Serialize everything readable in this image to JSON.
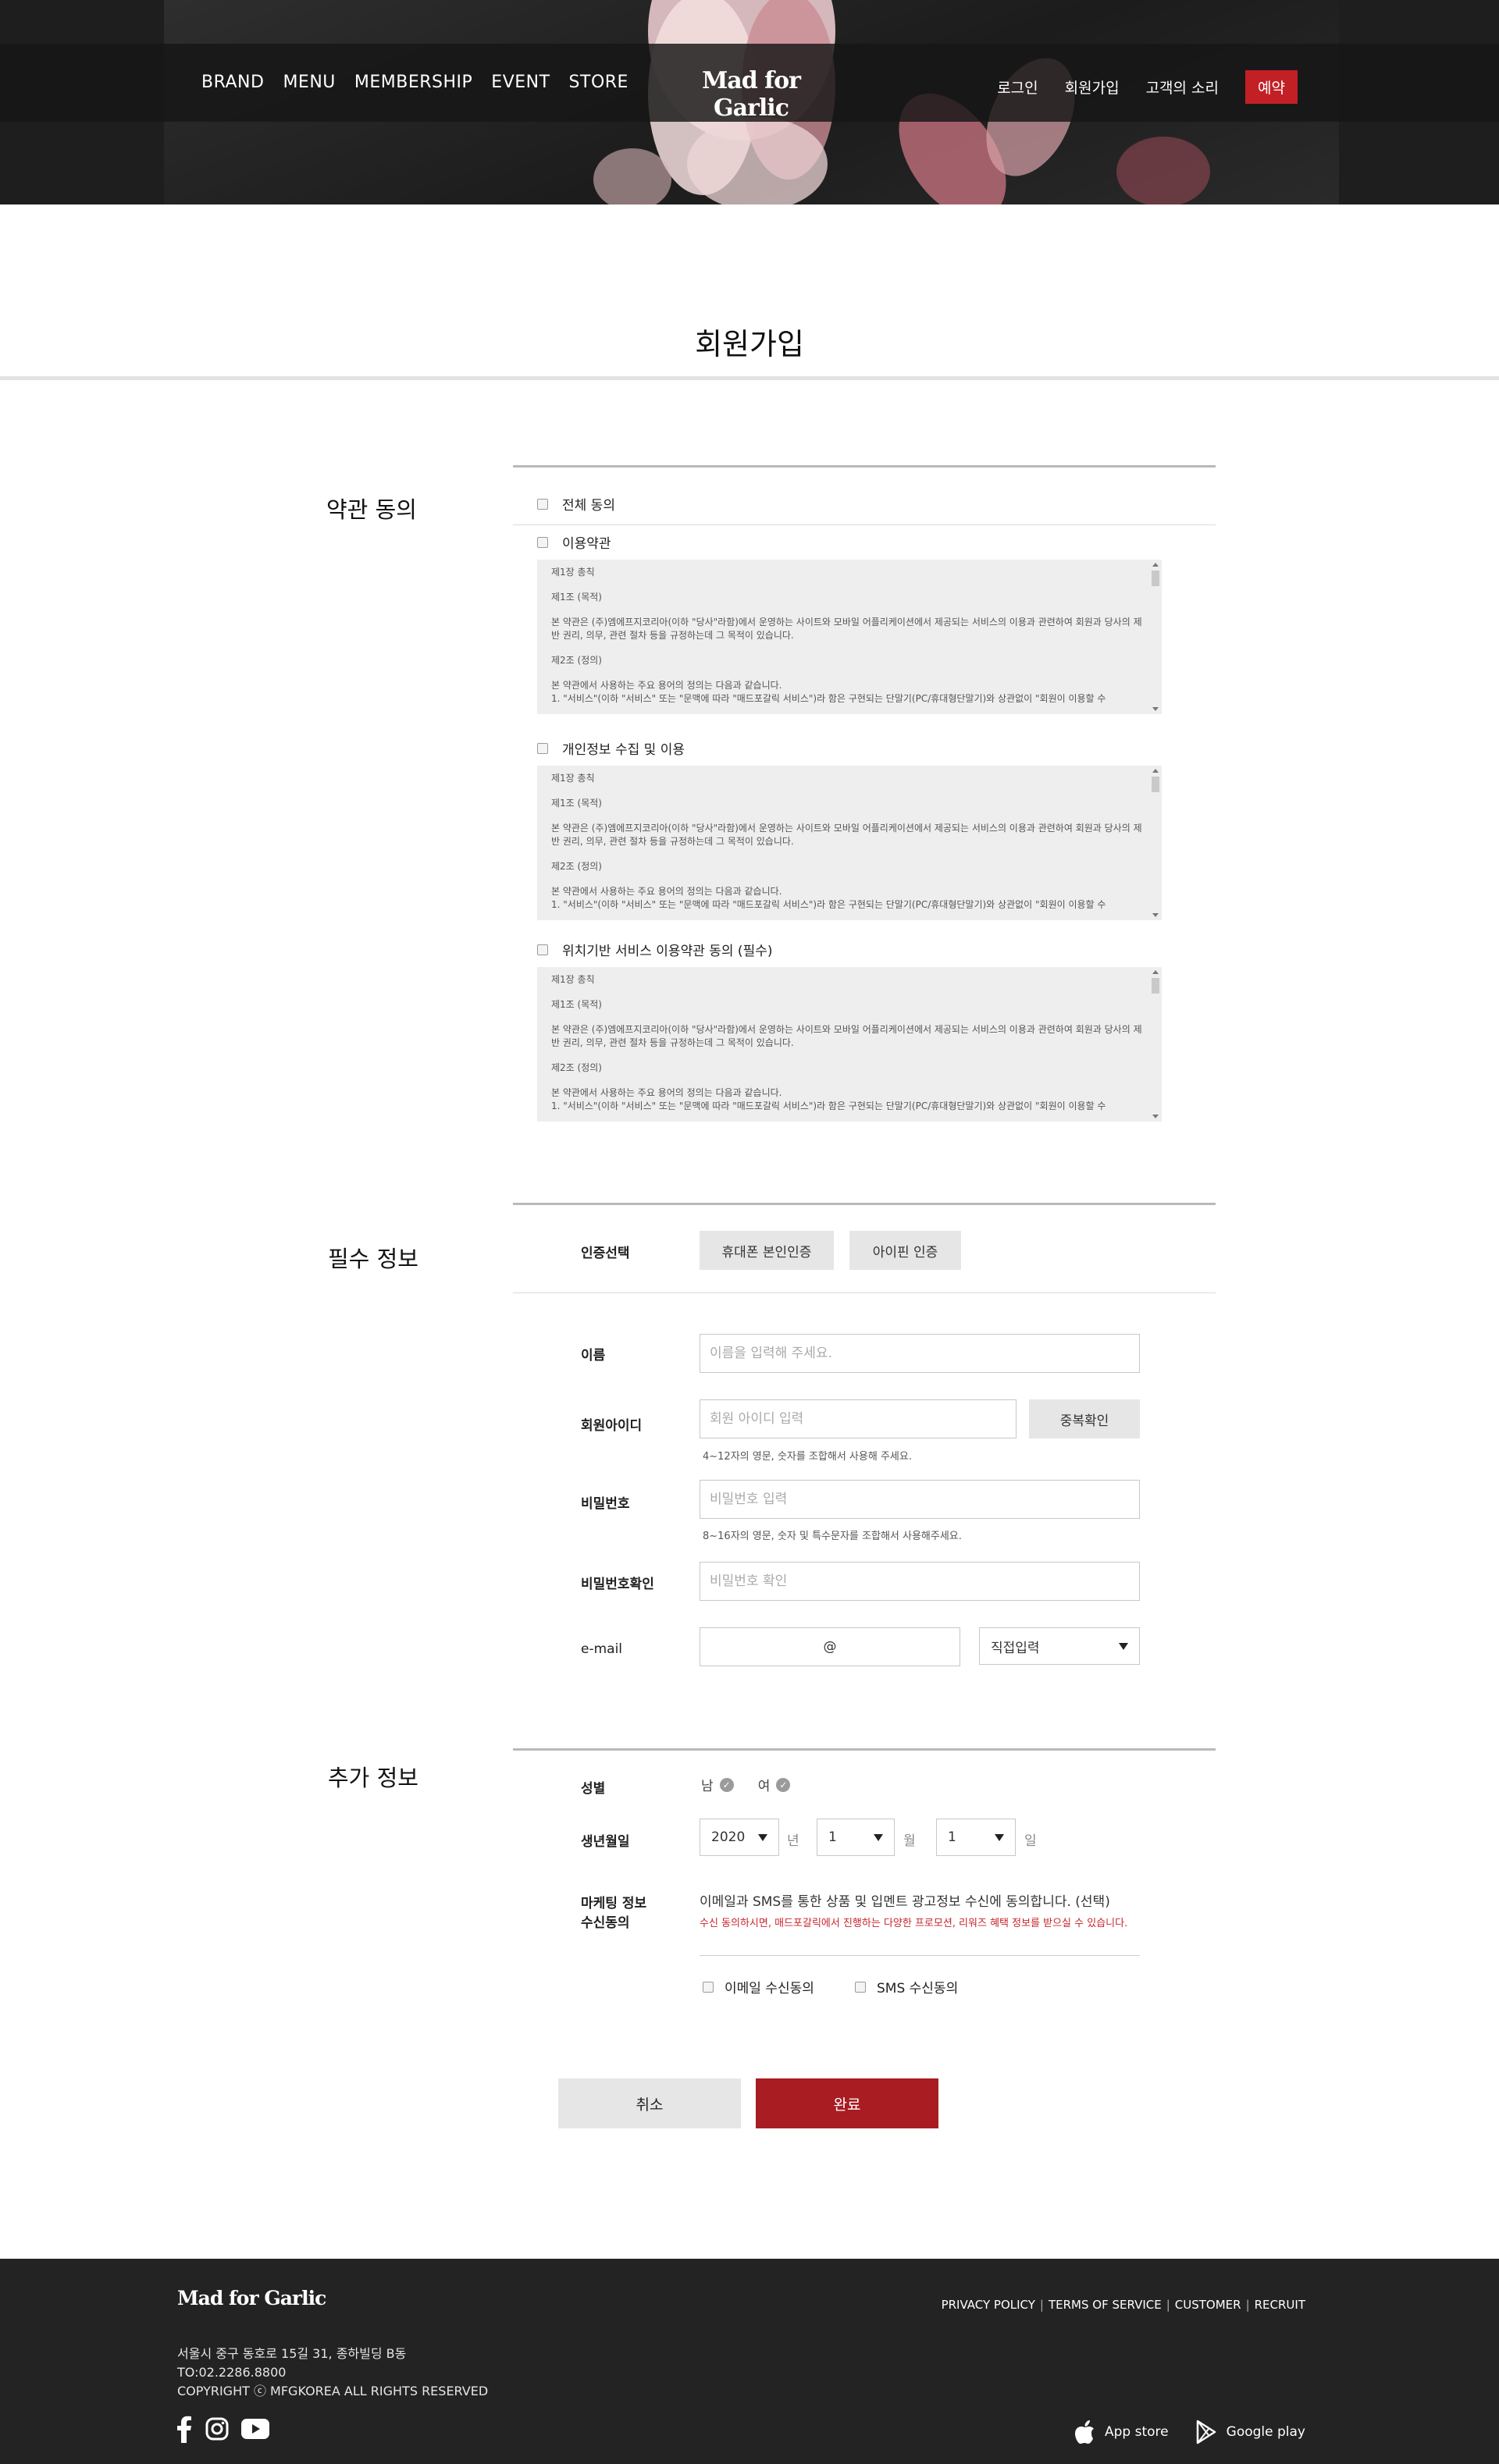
{
  "nav": {
    "left": [
      "BRAND",
      "MENU",
      "MEMBERSHIP",
      "EVENT",
      "STORE"
    ],
    "logo": "Mad for Garlic",
    "right": [
      "로그인",
      "회원가입",
      "고객의 소리"
    ],
    "reserve": "예약",
    "accent_color": "#c32026"
  },
  "page_title": "회원가입",
  "terms": {
    "section_title": "약관 동의",
    "agree_all": "전체 동의",
    "items": [
      {
        "label": "이용약관",
        "lines": [
          "제1장 총칙",
          "제1조 (목적)",
          "본 약관은 (주)엠에프지코리아(이하 \"당사\"라함)에서 운영하는 사이트와 모바일 어플리케이션에서 제공되는 서비스의 이용과 관련하여 회원과 당사의 제반 권리, 의무, 관련 절차 등을 규정하는데 그 목적이 있습니다.",
          "제2조 (정의)",
          "본 약관에서 사용하는 주요 용어의 정의는 다음과 같습니다.",
          "1. \"서비스\"(이하 \"서비스\" 또는 \"문맥에 따라 \"매드포갈릭 서비스\")라 함은 구현되는 단말기(PC/휴대형단말기)와 상관없이 \"회원이 이용할 수"
        ]
      },
      {
        "label": "개인정보 수집 및 이용",
        "lines": [
          "제1장 총칙",
          "제1조 (목적)",
          "본 약관은 (주)엠에프지코리아(이하 \"당사\"라함)에서 운영하는 사이트와 모바일 어플리케이션에서 제공되는 서비스의 이용과 관련하여 회원과 당사의 제반 권리, 의무, 관련 절차 등을 규정하는데 그 목적이 있습니다.",
          "제2조 (정의)",
          "본 약관에서 사용하는 주요 용어의 정의는 다음과 같습니다.",
          "1. \"서비스\"(이하 \"서비스\" 또는 \"문맥에 따라 \"매드포갈릭 서비스\")라 함은 구현되는 단말기(PC/휴대형단말기)와 상관없이 \"회원이 이용할 수"
        ]
      },
      {
        "label": "위치기반 서비스 이용약관 동의 (필수)",
        "lines": [
          "제1장 총칙",
          "제1조 (목적)",
          "본 약관은 (주)엠에프지코리아(이하 \"당사\"라함)에서 운영하는 사이트와 모바일 어플리케이션에서 제공되는 서비스의 이용과 관련하여 회원과 당사의 제반 권리, 의무, 관련 절차 등을 규정하는데 그 목적이 있습니다.",
          "제2조 (정의)",
          "본 약관에서 사용하는 주요 용어의 정의는 다음과 같습니다.",
          "1. \"서비스\"(이하 \"서비스\" 또는 \"문맥에 따라 \"매드포갈릭 서비스\")라 함은 구현되는 단말기(PC/휴대형단말기)와 상관없이 \"회원이 이용할 수"
        ]
      }
    ]
  },
  "required": {
    "section_title": "필수 정보",
    "auth_label": "인증선택",
    "auth_phone": "휴대폰 본인인증",
    "auth_ipin": "아이핀 인증",
    "name_label": "이름",
    "name_placeholder": "이름을 입력해 주세요.",
    "id_label": "회원아이디",
    "id_placeholder": "회원 아이디 입력",
    "id_check": "중복확인",
    "id_help": "4~12자의 영문, 숫자를 조합해서 사용해 주세요.",
    "pw_label": "비밀번호",
    "pw_placeholder": "비밀번호 입력",
    "pw_help": "8~16자의 영문, 숫자 및 특수문자를 조합해서 사용해주세요.",
    "pw2_label": "비밀번호확인",
    "pw2_placeholder": "비밀번호 확인",
    "email_label": "e-mail",
    "email_at": "@",
    "email_select": "직접입력"
  },
  "extra": {
    "section_title": "추가 정보",
    "gender_label": "성별",
    "gender_male": "남",
    "gender_female": "여",
    "birth_label": "생년월일",
    "birth_year": "2020",
    "birth_year_suffix": "년",
    "birth_month": "1",
    "birth_month_suffix": "월",
    "birth_day": "1",
    "birth_day_suffix": "일",
    "marketing_label_1": "마케팅 정보",
    "marketing_label_2": "수신동의",
    "marketing_text": "이메일과 SMS를 통한 상품 및 입멘트 광고정보 수신에 동의합니다. (선택)",
    "marketing_note": "수신 동의하시면, 매드포갈릭에서 진행하는 다양한 프로모션, 리워즈 혜택 정보를 받으실 수 있습니다.",
    "email_consent": "이메일 수신동의",
    "sms_consent": "SMS 수신동의"
  },
  "buttons": {
    "cancel": "취소",
    "done": "완료"
  },
  "footer": {
    "logo": "Mad for Garlic",
    "links": [
      "PRIVACY POLICY",
      "TERMS OF SERVICE",
      "CUSTOMER",
      "RECRUIT"
    ],
    "address": "서울시 중구 동호로 15길 31, 종하빌딩 B동",
    "tel": "TO:02.2286.8800",
    "copyright": "COPYRIGHT ⓒ MFGKOREA ALL RIGHTS RESERVED",
    "app_store": "App store",
    "google_play": "Google play",
    "social_icons": [
      "facebook-icon",
      "instagram-icon",
      "youtube-icon"
    ]
  }
}
